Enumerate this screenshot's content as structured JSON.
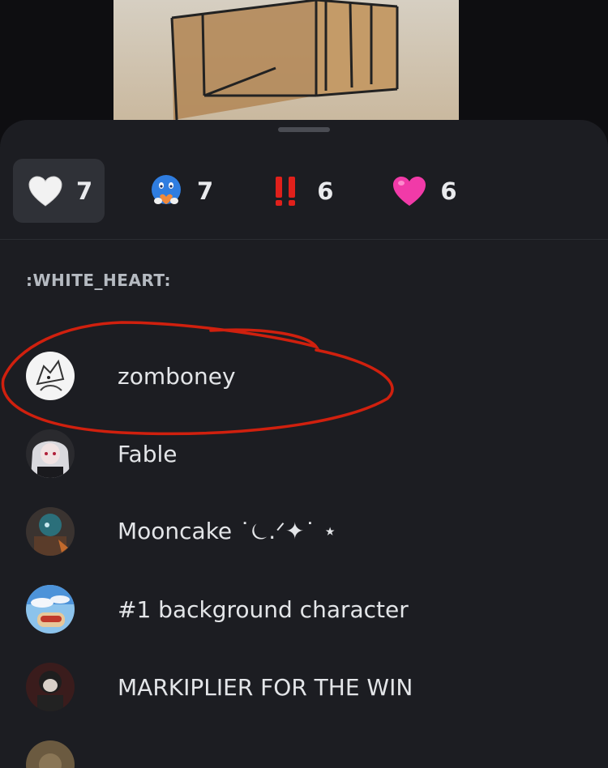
{
  "reactions": [
    {
      "icon": "white-heart-icon",
      "count": "7",
      "active": true
    },
    {
      "icon": "blue-face-holding-heart-icon",
      "count": "7",
      "active": false
    },
    {
      "icon": "double-exclamation-icon",
      "count": "6",
      "active": false
    },
    {
      "icon": "pink-heart-icon",
      "count": "6",
      "active": false
    }
  ],
  "section_title": ":WHITE_HEART:",
  "users": [
    {
      "name": "zomboney"
    },
    {
      "name": "Fable"
    },
    {
      "name": "Mooncake ˙⏾.ᐟ✦˙ ⋆"
    },
    {
      "name": "#1 background character"
    },
    {
      "name": "MARKIPLIER FOR THE WIN"
    },
    {
      "name": ""
    }
  ],
  "colors": {
    "sheet_bg": "#1c1d22",
    "active_chip": "#2f3137",
    "annotation_red": "#d0200e"
  }
}
